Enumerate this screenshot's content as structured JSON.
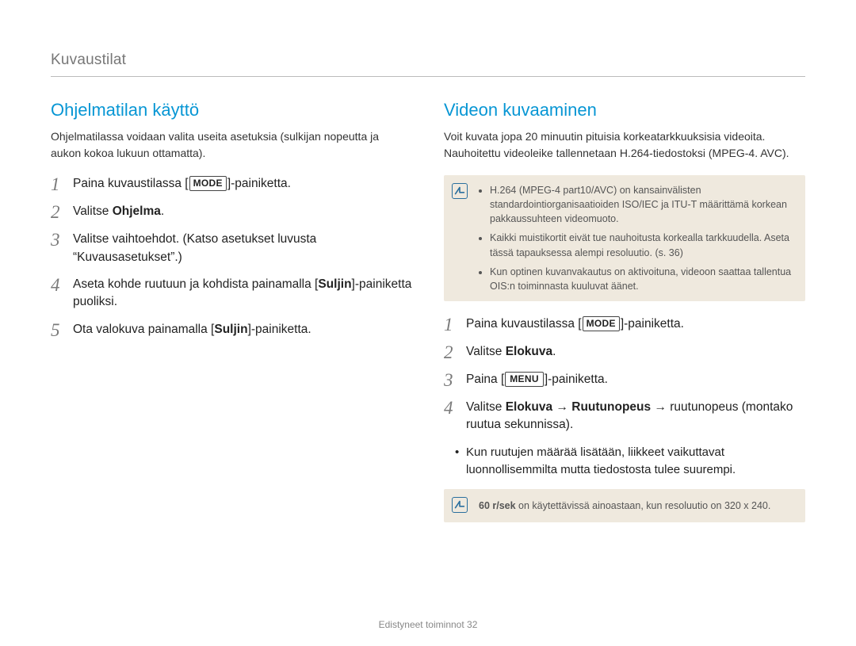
{
  "breadcrumb": "Kuvaustilat",
  "left": {
    "heading": "Ohjelmatilan käyttö",
    "intro": "Ohjelmatilassa voidaan valita useita asetuksia (sulkijan nopeutta ja aukon kokoa lukuun ottamatta).",
    "steps": {
      "s1_pre": "Paina kuvaustilassa [",
      "s1_btn": "MODE",
      "s1_post": "]-painiketta.",
      "s2_pre": "Valitse ",
      "s2_bold": "Ohjelma",
      "s2_post": ".",
      "s3": "Valitse vaihtoehdot. (Katso asetukset luvusta “Kuvausasetukset”.)",
      "s4_pre": "Aseta kohde ruutuun ja kohdista painamalla [",
      "s4_bold": "Suljin",
      "s4_post": "]-painiketta puoliksi.",
      "s5_pre": "Ota valokuva painamalla [",
      "s5_bold": "Suljin",
      "s5_post": "]-painiketta."
    }
  },
  "right": {
    "heading": "Videon kuvaaminen",
    "intro": "Voit kuvata jopa 20 minuutin pituisia korkeatarkkuuksisia videoita. Nauhoitettu videoleike tallennetaan H.264-tiedostoksi (MPEG-4. AVC).",
    "note_items": [
      "H.264 (MPEG-4 part10/AVC) on kansainvälisten standardointiorganisaatioiden ISO/IEC ja ITU-T määrittämä korkean pakkaussuhteen videomuoto.",
      "Kaikki muistikortit eivät tue nauhoitusta korkealla tarkkuudella. Aseta tässä tapauksessa alempi resoluutio. (s. 36)",
      "Kun optinen kuvanvakautus on aktivoituna, videoon saattaa tallentua OIS:n toiminnasta kuuluvat äänet."
    ],
    "steps": {
      "s1_pre": "Paina kuvaustilassa [",
      "s1_btn": "MODE",
      "s1_post": "]-painiketta.",
      "s2_pre": "Valitse ",
      "s2_bold": "Elokuva",
      "s2_post": ".",
      "s3_pre": "Paina [",
      "s3_btn": "MENU",
      "s3_post": "]-painiketta.",
      "s4_pre": "Valitse ",
      "s4_b1": "Elokuva",
      "s4_arrow1": " → ",
      "s4_b2": "Ruutunopeus",
      "s4_arrow2": " → ",
      "s4_post": "ruutunopeus (montako ruutua sekunnissa).",
      "s4_sub": "Kun ruutujen määrää lisätään, liikkeet vaikuttavat luonnollisemmilta mutta tiedostosta tulee suurempi."
    },
    "note2_bold": "60 r/sek",
    "note2_rest": " on käytettävissä ainoastaan, kun resoluutio on 320 x 240."
  },
  "footer_text": "Edistyneet toiminnot",
  "footer_page": "32"
}
